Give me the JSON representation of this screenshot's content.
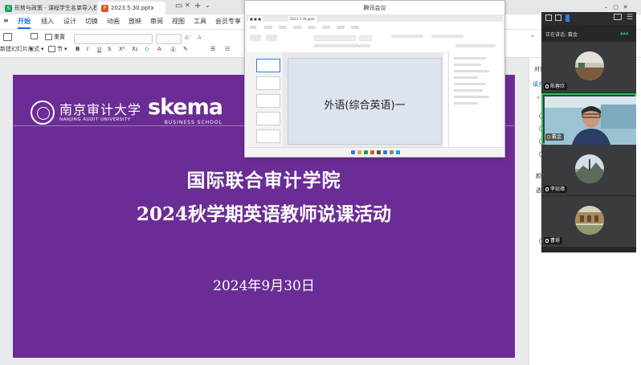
{
  "tabs": [
    {
      "label": "形势与政策 - 课程学生名单导入模板",
      "icon": "spreadsheet-icon",
      "color": "#19a05a"
    },
    {
      "label": "2023.5.30.pptx",
      "icon": "presentation-icon",
      "color": "#e0531c"
    }
  ],
  "menu": {
    "items": [
      "开始",
      "插入",
      "设计",
      "切换",
      "动画",
      "放映",
      "审阅",
      "视图",
      "工具",
      "会员专享"
    ],
    "active": "开始",
    "accent": "#1d6fe0"
  },
  "ribbon": {
    "format_painter": "格式",
    "new_slide": "新建幻灯片",
    "layout": "版式",
    "section": "节",
    "reset": "重置"
  },
  "slide": {
    "background": "#6b2d95",
    "nau_name_zh": "南京审计大学",
    "nau_name_en": "NANJING AUDIT UNIVERSITY",
    "skema_word": "skema",
    "skema_sub": "BUSINESS SCHOOL",
    "title_line1": "国际联合审计学院",
    "title_line2": "2024秋学期英语教师说课活动",
    "date": "2024年9月30日"
  },
  "side_pane": {
    "object_label": "对象",
    "fill_label": "填充",
    "labels": [
      "颜",
      "透"
    ]
  },
  "meeting_window": {
    "title": "腾讯会议",
    "inner_tab": "2023.5.30.pptx",
    "shared_slide_text": "外语(综合英语)一"
  },
  "participants": {
    "speaking_label": "正在讲话:",
    "speaking_name": "戴金",
    "active_color": "#24c35a",
    "tiles": [
      {
        "name": "陈蓉欣",
        "mic": "on",
        "active": false
      },
      {
        "name": "戴金",
        "mic": "on",
        "active": true
      },
      {
        "name": "李宛璋",
        "mic": "on",
        "active": false
      },
      {
        "name": "曹璟",
        "mic": "on",
        "active": false
      }
    ]
  }
}
